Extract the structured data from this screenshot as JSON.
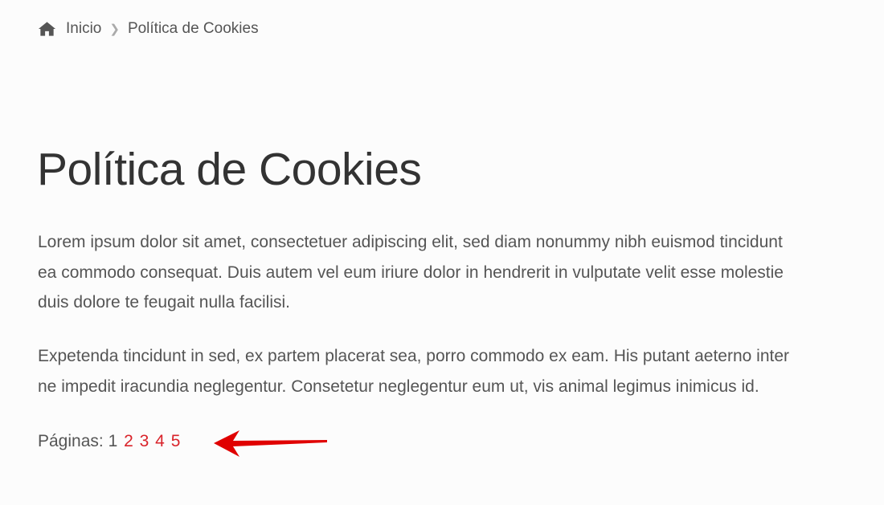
{
  "breadcrumb": {
    "home_icon": "home-icon",
    "home_label": "Inicio",
    "separator_icon": "chevron-right-icon",
    "current": "Política de Cookies"
  },
  "page": {
    "title": "Política de Cookies",
    "paragraphs": [
      [
        "Lorem ipsum dolor sit amet, consectetuer adipiscing elit, sed diam nonummy nibh euismod tincidunt",
        "ea commodo consequat. Duis autem vel eum iriure dolor in hendrerit in vulputate velit esse molestie",
        "duis dolore te feugait nulla facilisi."
      ],
      [
        "Expetenda tincidunt in sed, ex partem placerat sea, porro commodo ex eam. His putant aeterno inter",
        "ne impedit iracundia neglegentur. Consetetur neglegentur eum ut, vis animal legimus inimicus id."
      ]
    ]
  },
  "pagination": {
    "label": "Páginas:",
    "current": "1",
    "links": [
      "2",
      "3",
      "4",
      "5"
    ]
  },
  "annotation": {
    "arrow_icon": "red-arrow-icon",
    "color": "#e00000"
  },
  "colors": {
    "link": "#d9232a",
    "text": "#555555",
    "title": "#333333"
  }
}
